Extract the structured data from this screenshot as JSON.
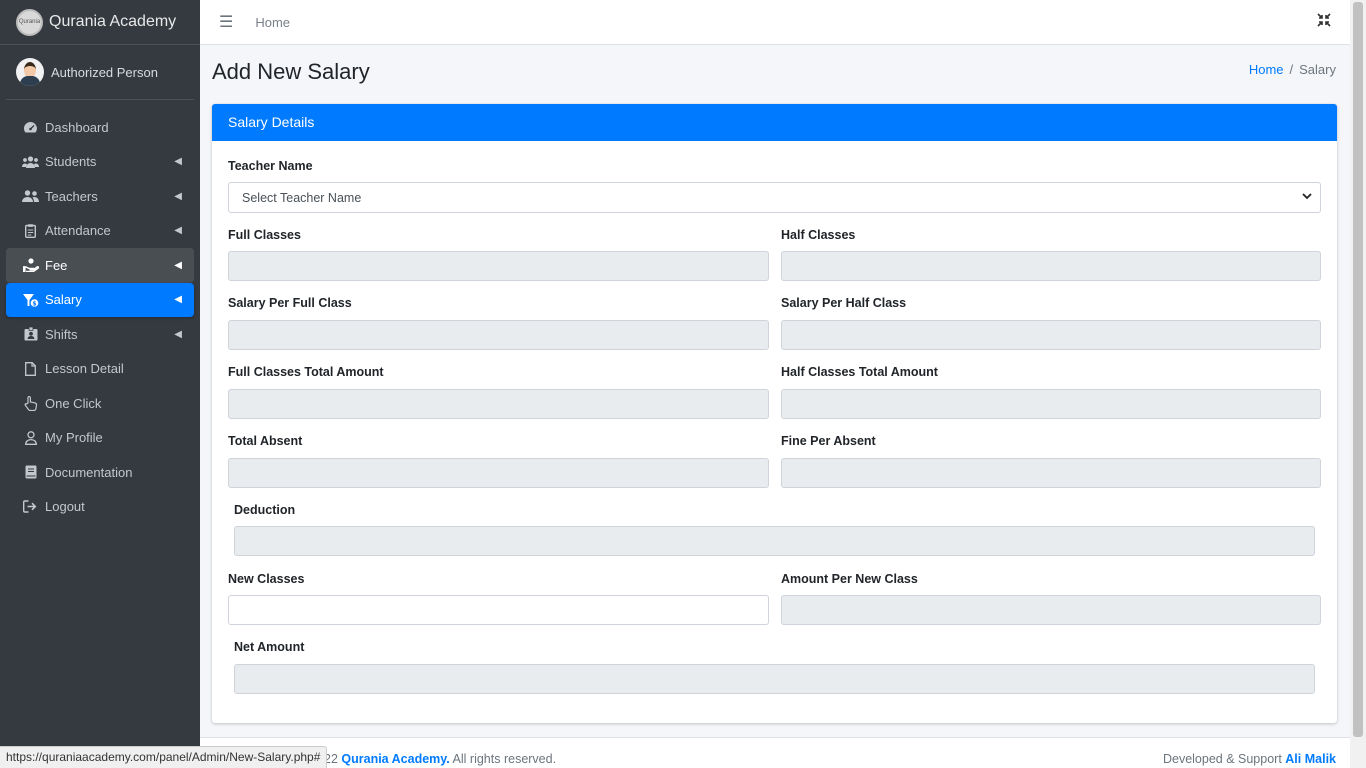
{
  "brand": {
    "name": "Qurania Academy",
    "logo_text": "Qurania"
  },
  "user": {
    "name": "Authorized Person"
  },
  "sidebar": {
    "items": [
      {
        "label": "Dashboard",
        "icon": "tachometer-icon",
        "arrow": false
      },
      {
        "label": "Students",
        "icon": "users-icon",
        "arrow": true
      },
      {
        "label": "Teachers",
        "icon": "user-friends-icon",
        "arrow": true
      },
      {
        "label": "Attendance",
        "icon": "clipboard-icon",
        "arrow": true
      },
      {
        "label": "Fee",
        "icon": "hand-holding-icon",
        "arrow": true
      },
      {
        "label": "Salary",
        "icon": "money-sign-icon",
        "arrow": true
      },
      {
        "label": "Shifts",
        "icon": "id-badge-icon",
        "arrow": true
      },
      {
        "label": "Lesson Detail",
        "icon": "file-icon",
        "arrow": false
      },
      {
        "label": "One Click",
        "icon": "hand-pointer-icon",
        "arrow": false
      },
      {
        "label": "My Profile",
        "icon": "user-icon",
        "arrow": false
      },
      {
        "label": "Documentation",
        "icon": "book-icon",
        "arrow": false
      },
      {
        "label": "Logout",
        "icon": "sign-out-icon",
        "arrow": false
      }
    ]
  },
  "topbar": {
    "home_link": "Home"
  },
  "page": {
    "title": "Add New Salary",
    "breadcrumb": {
      "home": "Home",
      "separator": "/",
      "current": "Salary"
    }
  },
  "card": {
    "header": "Salary Details",
    "teacher_label": "Teacher Name",
    "teacher_placeholder": "Select Teacher Name",
    "fields": {
      "full_classes": "Full Classes",
      "half_classes": "Half Classes",
      "salary_per_full": "Salary Per Full Class",
      "salary_per_half": "Salary Per Half Class",
      "full_total": "Full Classes Total Amount",
      "half_total": "Half Classes Total Amount",
      "total_absent": "Total Absent",
      "fine_per_absent": "Fine Per Absent",
      "deduction": "Deduction",
      "new_classes": "New Classes",
      "amount_per_new": "Amount Per New Class",
      "net_amount": "Net Amount"
    }
  },
  "footer": {
    "left_prefix": "22",
    "left_brand": "Qurania Academy.",
    "left_suffix": " All rights reserved.",
    "right_prefix": "Developed & Support ",
    "right_name": "Ali Malik"
  },
  "status_bar": {
    "url": "https://quraniaacademy.com/panel/Admin/New-Salary.php#"
  },
  "colors": {
    "primary": "#007bff",
    "sidebar_bg": "#343a40",
    "readonly_bg": "#e9ecef"
  }
}
